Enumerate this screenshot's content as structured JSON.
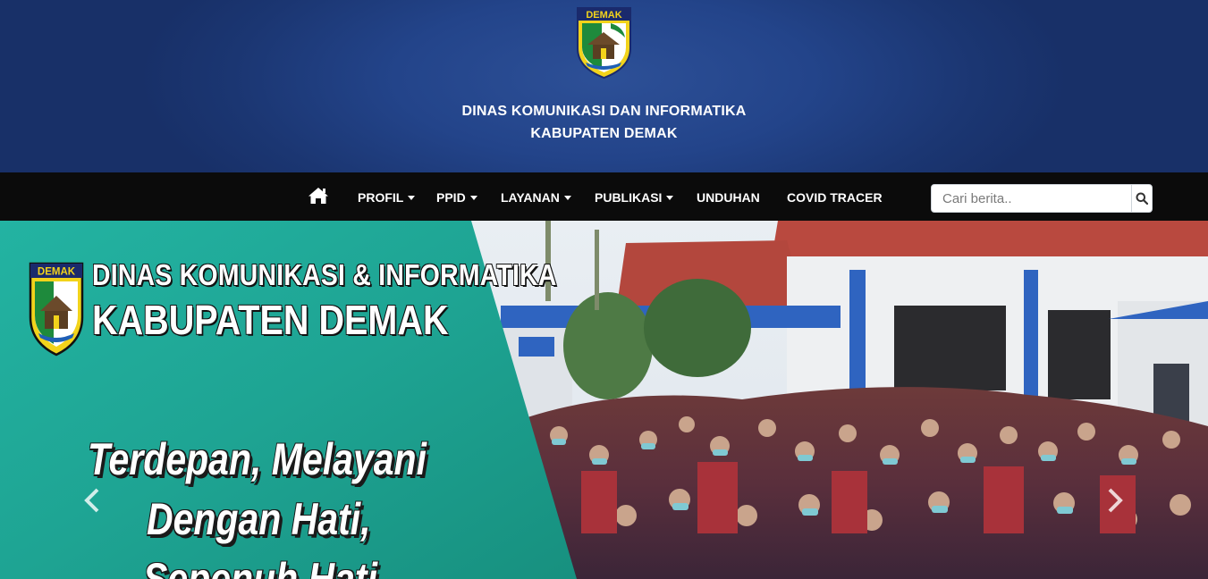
{
  "header": {
    "emblem_label": "DEMAK",
    "title_line1": "DINAS KOMUNIKASI DAN INFORMATIKA",
    "title_line2": "KABUPATEN DEMAK"
  },
  "navbar": {
    "home_icon": "home-icon",
    "items": [
      {
        "label": "PROFIL",
        "dropdown": true
      },
      {
        "label": "PPID",
        "dropdown": true
      },
      {
        "label": "LAYANAN",
        "dropdown": true
      },
      {
        "label": "PUBLIKASI",
        "dropdown": true
      },
      {
        "label": "UNDUHAN",
        "dropdown": false
      },
      {
        "label": "COVID TRACER",
        "dropdown": false
      }
    ],
    "search": {
      "placeholder": "Cari berita..",
      "value": "",
      "icon": "search-icon"
    }
  },
  "hero": {
    "logo_label": "DEMAK",
    "title_line1": "DINAS KOMUNIKASI & INFORMATIKA",
    "title_line2": "KABUPATEN DEMAK",
    "tagline_line1": "Terdepan, Melayani",
    "tagline_line2": "Dengan Hati,",
    "tagline_line3": "Sepenuh Hati",
    "prev_icon": "chevron-left-icon",
    "next_icon": "chevron-right-icon"
  },
  "colors": {
    "header_bg": "#1f3f80",
    "navbar_bg": "#0b0b0b",
    "hero_teal": "#1fa99a",
    "emblem_yellow": "#f2d31b"
  }
}
